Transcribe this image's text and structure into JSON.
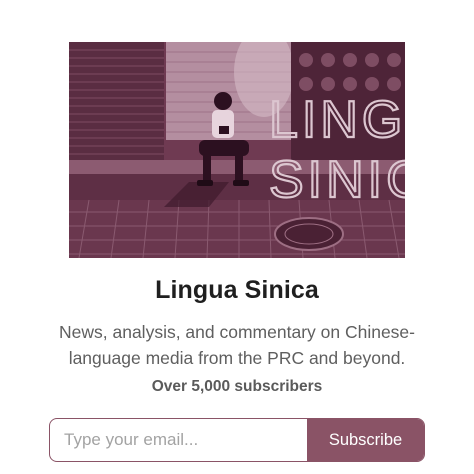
{
  "publication": {
    "logo_text": "LINGUA SINICA",
    "title": "Lingua Sinica",
    "description": "News, analysis, and commentary on Chinese-language media from the PRC and beyond.",
    "subscribers": "Over 5,000 subscribers"
  },
  "form": {
    "email_placeholder": "Type your email...",
    "subscribe_label": "Subscribe"
  },
  "colors": {
    "accent": "#8a5366",
    "hero_tint": "#6d3a50"
  }
}
